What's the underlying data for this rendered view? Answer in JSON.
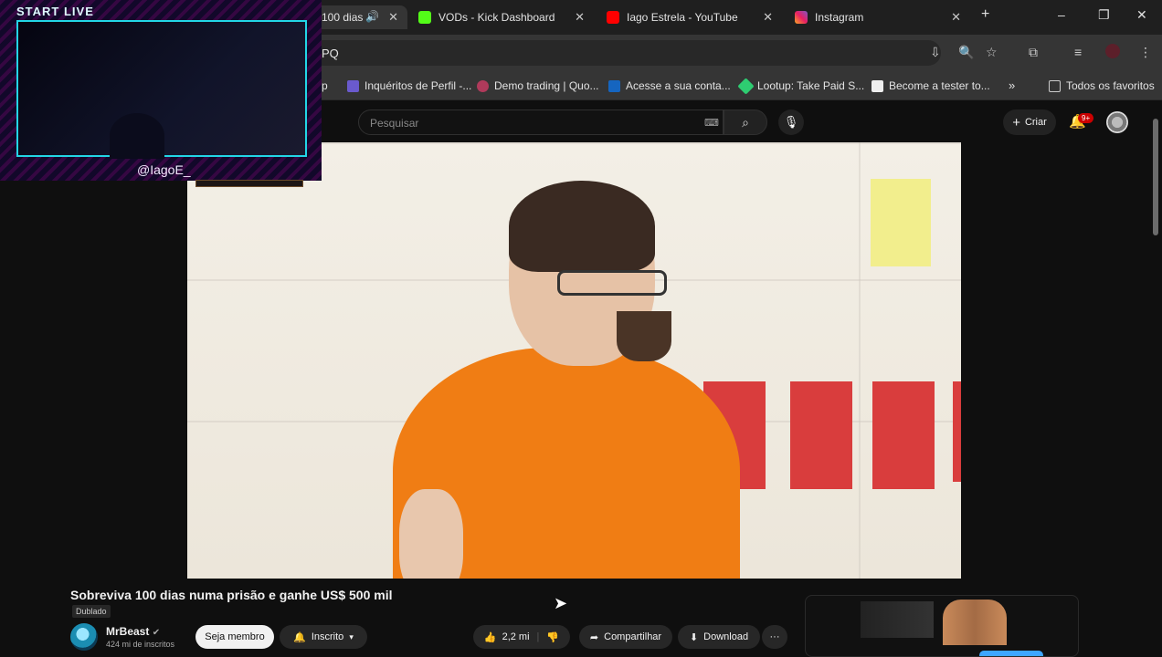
{
  "browser": {
    "tabs": [
      {
        "label": "100 dias",
        "active": true
      },
      {
        "label": "VODs - Kick Dashboard"
      },
      {
        "label": "Iago Estrela - YouTube"
      },
      {
        "label": "Instagram"
      }
    ],
    "new_tab": "+",
    "window_controls": {
      "minimize": "–",
      "restore": "❐",
      "close": "✕"
    },
    "address_fragment": "PQ",
    "bookmarks": [
      {
        "label": "p"
      },
      {
        "label": "Inquéritos de Perfil -..."
      },
      {
        "label": "Demo trading | Quo..."
      },
      {
        "label": "Acesse a sua conta..."
      },
      {
        "label": "Lootup: Take Paid S..."
      },
      {
        "label": "Become a tester to..."
      },
      {
        "label": "Todos os favoritos"
      }
    ]
  },
  "youtube": {
    "search_placeholder": "Pesquisar",
    "create_label": "Criar",
    "notifications": "9+",
    "video_title": "Sobreviva 100 dias numa prisão e ganhe US$ 500 mil",
    "dub_label": "Dublado",
    "channel": {
      "name": "MrBeast",
      "subs": "424 mi de inscritos"
    },
    "member_label": "Seja membro",
    "subscribed_label": "Inscrito",
    "likes": "2,2 mi",
    "share_label": "Compartilhar",
    "download_label": "Download",
    "more_label": "···"
  },
  "overlay": {
    "title": "START LIVE",
    "handle": "@IagoE_"
  },
  "colors": {
    "accent_cyan": "#22d6e6",
    "badge_red": "#cc0000",
    "jumpsuit_orange": "#f07d14"
  }
}
